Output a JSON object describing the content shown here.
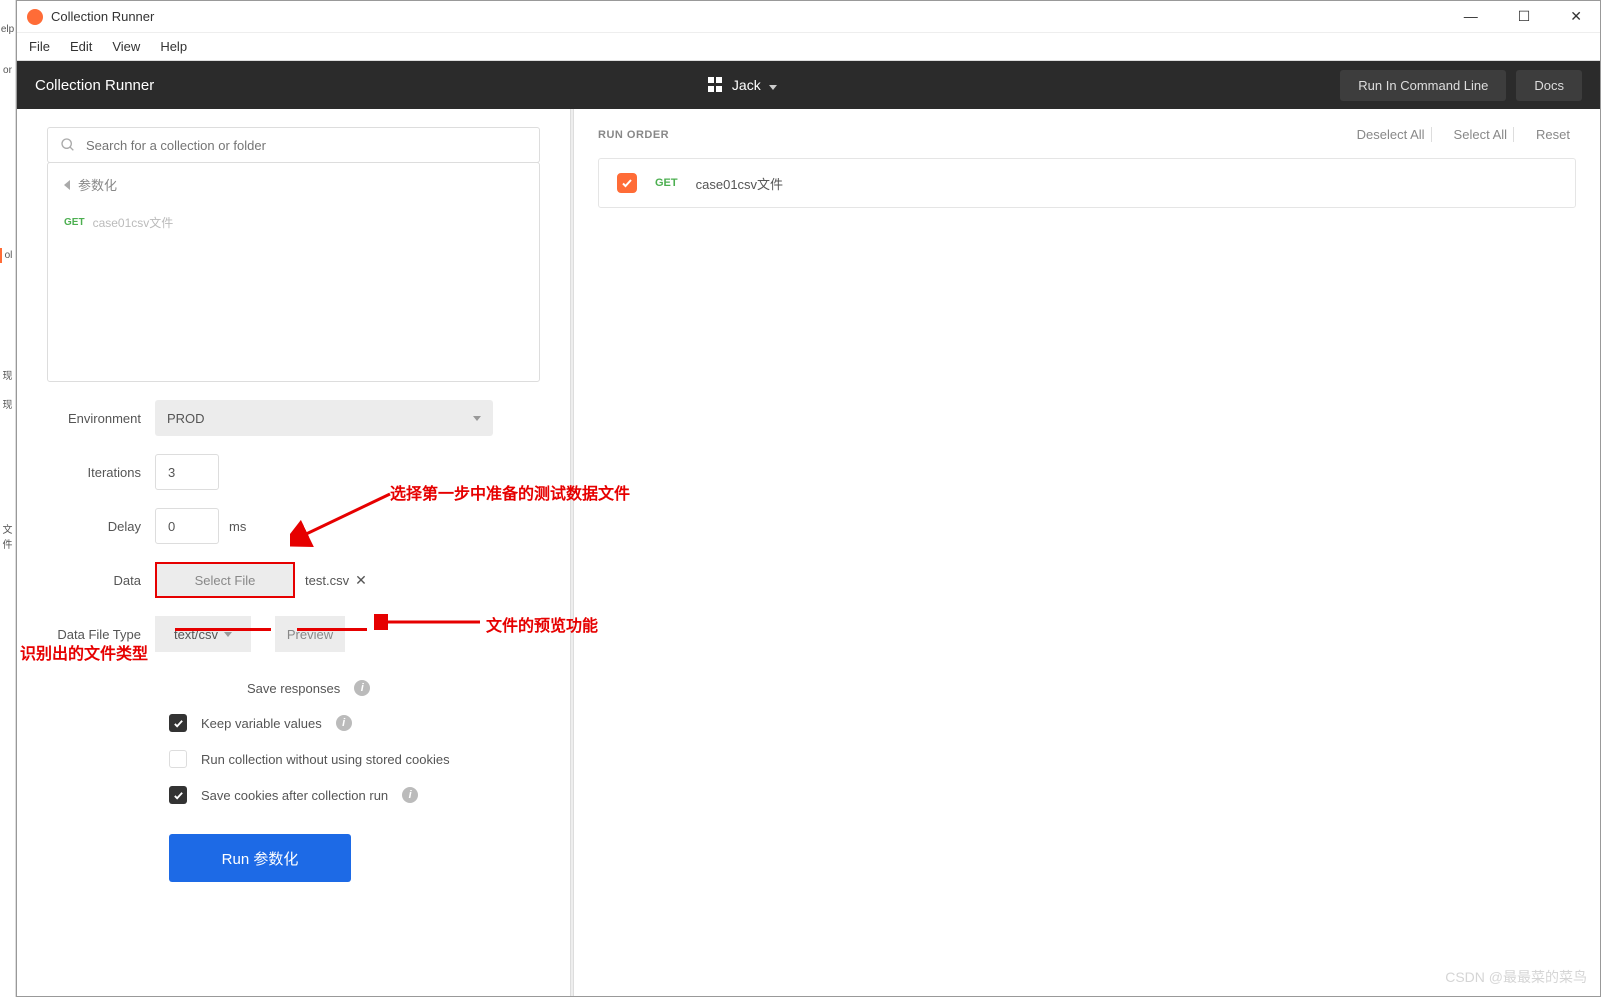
{
  "window": {
    "title": "Collection Runner"
  },
  "menubar": {
    "file": "File",
    "edit": "Edit",
    "view": "View",
    "help": "Help"
  },
  "header": {
    "title": "Collection Runner",
    "workspace": "Jack",
    "run_cli": "Run In Command Line",
    "docs": "Docs"
  },
  "left": {
    "search_placeholder": "Search for a collection or folder",
    "folder_name": "参数化",
    "request_method": "GET",
    "request_name": "case01csv文件",
    "env_label": "Environment",
    "env_value": "PROD",
    "iter_label": "Iterations",
    "iter_value": "3",
    "delay_label": "Delay",
    "delay_value": "0",
    "delay_unit": "ms",
    "data_label": "Data",
    "select_file_btn": "Select File",
    "data_filename": "test.csv",
    "filetype_label": "Data File Type",
    "filetype_value": "text/csv",
    "preview_btn": "Preview",
    "save_responses": "Save responses",
    "keep_vars": "Keep variable values",
    "no_cookies": "Run collection without using stored cookies",
    "save_cookies": "Save cookies after collection run",
    "run_btn": "Run 参数化"
  },
  "right": {
    "run_order": "RUN ORDER",
    "deselect": "Deselect All",
    "select_all": "Select All",
    "reset": "Reset",
    "req_method": "GET",
    "req_name": "case01csv文件"
  },
  "annotations": {
    "a1": "选择第一步中准备的测试数据文件",
    "a2": "文件的预览功能",
    "a3": "识别出的文件类型"
  },
  "watermark": "CSDN @最最菜的菜鸟",
  "leftstrip": {
    "help": "elp",
    "or": "or",
    "ol": "ol",
    "x1": "现",
    "x2": "现",
    "f": "文件"
  }
}
